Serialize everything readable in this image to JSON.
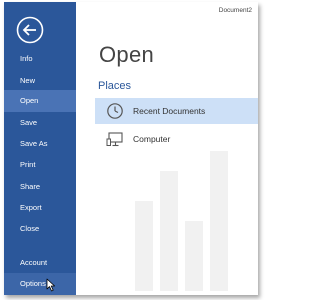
{
  "window": {
    "document_title": "Document2"
  },
  "sidebar": {
    "items": [
      {
        "label": "Info"
      },
      {
        "label": "New"
      },
      {
        "label": "Open"
      },
      {
        "label": "Save"
      },
      {
        "label": "Save As"
      },
      {
        "label": "Print"
      },
      {
        "label": "Share"
      },
      {
        "label": "Export"
      },
      {
        "label": "Close"
      },
      {
        "label": "Account"
      },
      {
        "label": "Options"
      }
    ],
    "selected": "Open",
    "hovered": "Options"
  },
  "main": {
    "title": "Open",
    "section": "Places",
    "places": [
      {
        "label": "Recent Documents",
        "icon": "clock-icon",
        "selected": true
      },
      {
        "label": "Computer",
        "icon": "computer-icon",
        "selected": false
      }
    ]
  },
  "colors": {
    "sidebar": "#2b579a",
    "sidebar_selected": "#4a73b5",
    "place_selected": "#cde0f7",
    "accent_text": "#2b579a"
  }
}
